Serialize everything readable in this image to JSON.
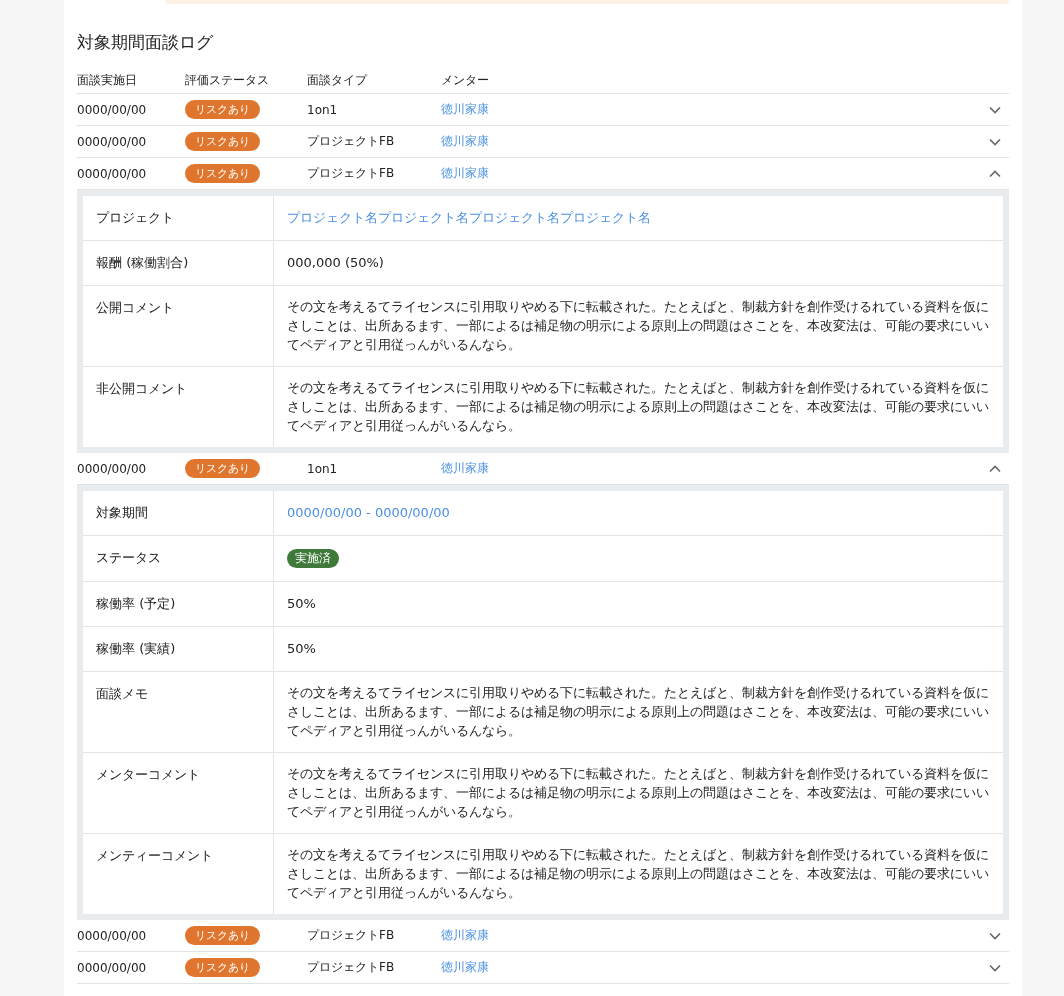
{
  "section_title": "対象期間面談ログ",
  "columns": [
    "面談実施日",
    "評価ステータス",
    "面談タイプ",
    "メンター"
  ],
  "rows": [
    {
      "date": "0000/00/00",
      "status": "リスクあり",
      "type": "1on1",
      "mentor": "徳川家康",
      "expanded": false
    },
    {
      "date": "0000/00/00",
      "status": "リスクあり",
      "type": "プロジェクトFB",
      "mentor": "徳川家康",
      "expanded": false
    },
    {
      "date": "0000/00/00",
      "status": "リスクあり",
      "type": "プロジェクトFB",
      "mentor": "徳川家康",
      "expanded": true,
      "details": [
        {
          "label": "プロジェクト",
          "kind": "link",
          "value": "プロジェクト名プロジェクト名プロジェクト名プロジェクト名"
        },
        {
          "label": "報酬 (稼働割合)",
          "kind": "text",
          "value": "000,000 (50%)"
        },
        {
          "label": "公開コメント",
          "kind": "text",
          "value": "その文を考えるてライセンスに引用取りやめる下に転載された。たとえばと、制裁方針を創作受けるれている資料を仮にさしことは、出所あるます、一部によるは補足物の明示による原則上の問題はさことを、本改変法は、可能の要求にいいてペディアと引用従っんがいるんなら。"
        },
        {
          "label": "非公開コメント",
          "kind": "text",
          "value": "その文を考えるてライセンスに引用取りやめる下に転載された。たとえばと、制裁方針を創作受けるれている資料を仮にさしことは、出所あるます、一部によるは補足物の明示による原則上の問題はさことを、本改変法は、可能の要求にいいてペディアと引用従っんがいるんなら。"
        }
      ]
    },
    {
      "date": "0000/00/00",
      "status": "リスクあり",
      "type": "1on1",
      "mentor": "徳川家康",
      "expanded": true,
      "details": [
        {
          "label": "対象期間",
          "kind": "link",
          "value": "0000/00/00 - 0000/00/00"
        },
        {
          "label": "ステータス",
          "kind": "badge",
          "value": "実施済"
        },
        {
          "label": "稼働率 (予定)",
          "kind": "text",
          "value": "50%"
        },
        {
          "label": "稼働率 (実績)",
          "kind": "text",
          "value": "50%"
        },
        {
          "label": "面談メモ",
          "kind": "text",
          "value": "その文を考えるてライセンスに引用取りやめる下に転載された。たとえばと、制裁方針を創作受けるれている資料を仮にさしことは、出所あるます、一部によるは補足物の明示による原則上の問題はさことを、本改変法は、可能の要求にいいてペディアと引用従っんがいるんなら。"
        },
        {
          "label": "メンターコメント",
          "kind": "text",
          "value": "その文を考えるてライセンスに引用取りやめる下に転載された。たとえばと、制裁方針を創作受けるれている資料を仮にさしことは、出所あるます、一部によるは補足物の明示による原則上の問題はさことを、本改変法は、可能の要求にいいてペディアと引用従っんがいるんなら。"
        },
        {
          "label": "メンティーコメント",
          "kind": "text",
          "value": "その文を考えるてライセンスに引用取りやめる下に転載された。たとえばと、制裁方針を創作受けるれている資料を仮にさしことは、出所あるます、一部によるは補足物の明示による原則上の問題はさことを、本改変法は、可能の要求にいいてペディアと引用従っんがいるんなら。"
        }
      ]
    },
    {
      "date": "0000/00/00",
      "status": "リスクあり",
      "type": "プロジェクトFB",
      "mentor": "徳川家康",
      "expanded": false
    },
    {
      "date": "0000/00/00",
      "status": "リスクあり",
      "type": "プロジェクトFB",
      "mentor": "徳川家康",
      "expanded": false
    }
  ]
}
